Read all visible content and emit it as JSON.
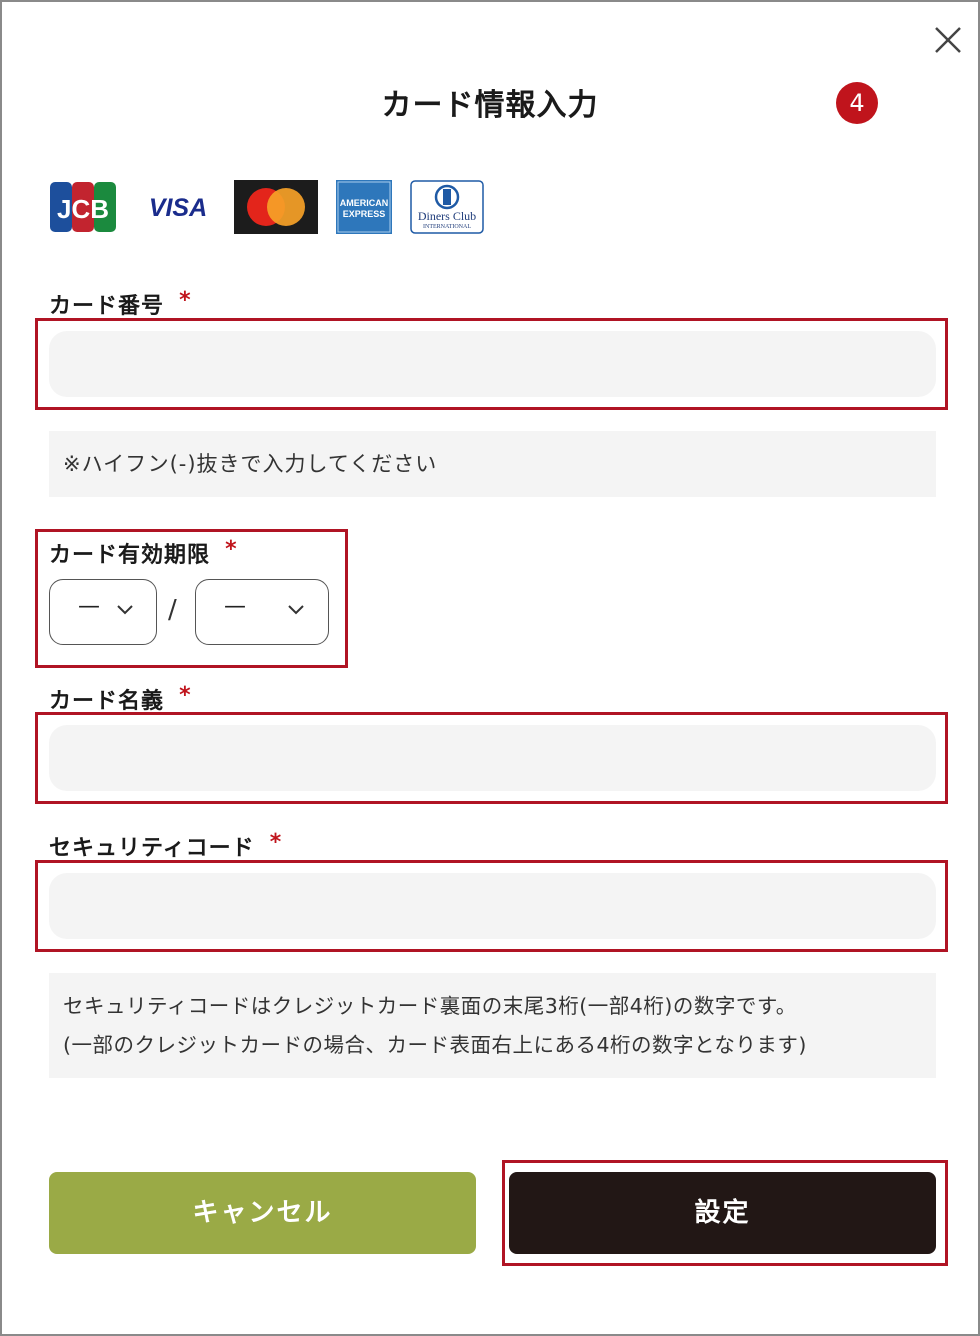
{
  "dialog": {
    "title": "カード情報入力",
    "step": "4"
  },
  "brands": {
    "jcb": "JCB",
    "visa": "VISA",
    "amex_line1": "AMERICAN",
    "amex_line2": "EXPRESS",
    "diners_line1": "Diners Club",
    "diners_line2": "INTERNATIONAL"
  },
  "form": {
    "required_mark": "*",
    "card_number": {
      "label": "カード番号",
      "value": "",
      "note": "※ハイフン(-)抜きで入力してください"
    },
    "expiry": {
      "label": "カード有効期限",
      "month": "—",
      "year": "—",
      "separator": "/"
    },
    "holder": {
      "label": "カード名義",
      "value": ""
    },
    "security": {
      "label": "セキュリティコード",
      "value": "",
      "note_line1": "セキュリティコードはクレジットカード裏面の末尾3桁(一部4桁)の数字です。",
      "note_line2": "(一部のクレジットカードの場合、カード表面右上にある4桁の数字となります)"
    }
  },
  "actions": {
    "cancel": "キャンセル",
    "submit": "設定"
  },
  "colors": {
    "highlight": "#b01424",
    "badge": "#c0141c",
    "cancel_bg": "#9aaa46",
    "submit_bg": "#221715"
  }
}
